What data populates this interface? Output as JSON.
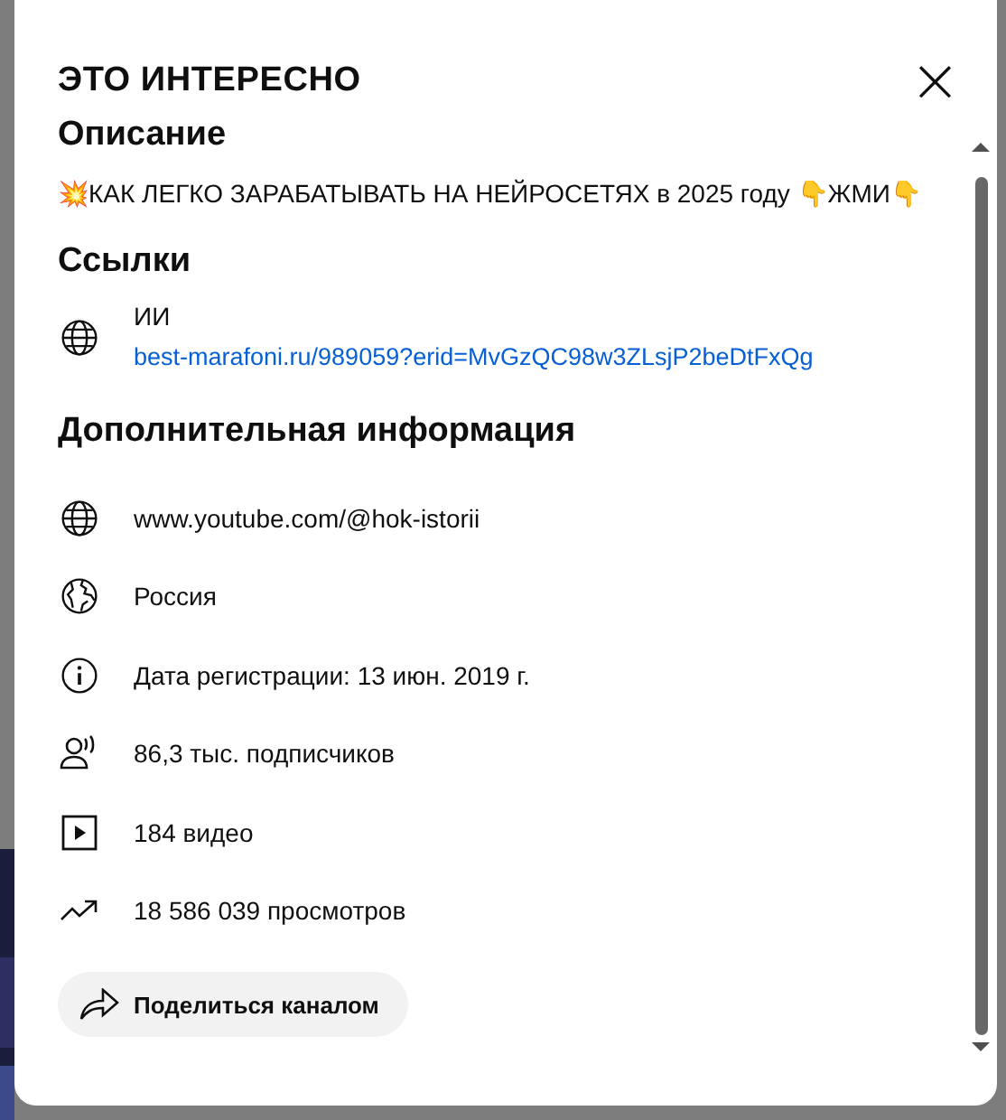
{
  "dialog": {
    "title": "ЭТО ИНТЕРЕСНО",
    "close_icon": "×"
  },
  "description": {
    "heading": "Описание",
    "text": "💥КАК ЛЕГКО ЗАРАБАТЫВАТЬ НА НЕЙРОСЕТЯХ в 2025 году 👇ЖМИ👇"
  },
  "links": {
    "heading": "Ссылки",
    "items": [
      {
        "title": "ИИ",
        "url": "best-marafoni.ru/989059?erid=MvGzQC98w3ZLsjP2beDtFxQg"
      }
    ]
  },
  "details": {
    "heading": "Дополнительная информация",
    "items": [
      {
        "kind": "globe",
        "text": "www.youtube.com/@hok-istorii"
      },
      {
        "kind": "earth",
        "text": "Россия"
      },
      {
        "kind": "info",
        "text": "Дата регистрации: 13 июн. 2019 г."
      },
      {
        "kind": "people",
        "text": "86,3 тыс. подписчиков"
      },
      {
        "kind": "video",
        "text": "184 видео"
      },
      {
        "kind": "trend",
        "text": "18 586 039 просмотров"
      }
    ]
  },
  "share_button": {
    "label": "Поделиться каналом"
  }
}
